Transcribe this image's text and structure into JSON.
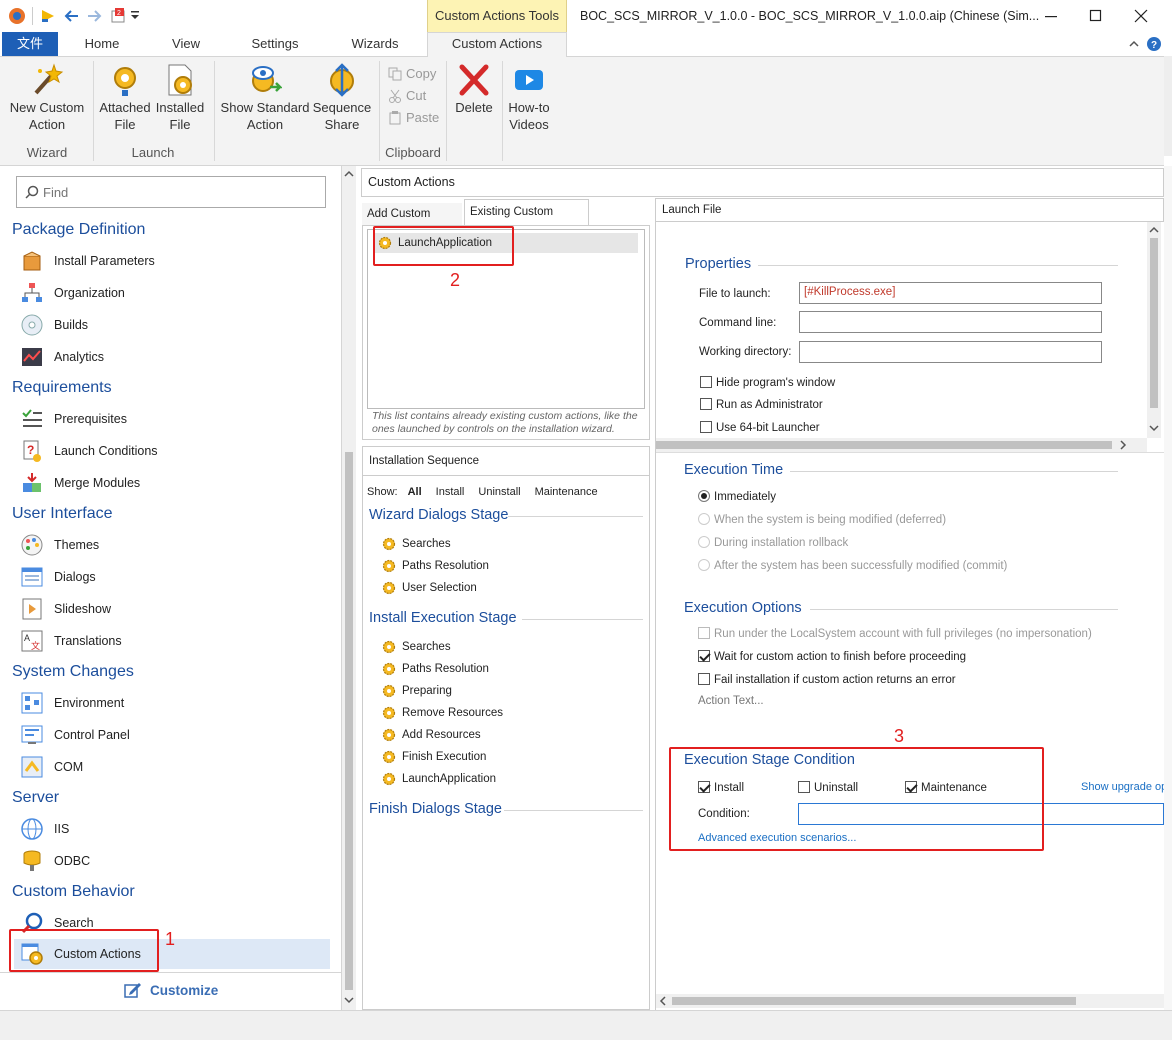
{
  "titlebar": {
    "context_tab": "Custom Actions Tools",
    "title": "BOC_SCS_MIRROR_V_1.0.0 - BOC_SCS_MIRROR_V_1.0.0.aip (Chinese (Sim..."
  },
  "tabs": {
    "file": "文件",
    "home": "Home",
    "view": "View",
    "settings": "Settings",
    "wizards": "Wizards",
    "custom_actions": "Custom Actions"
  },
  "ribbon": {
    "new_custom_action_1": "New Custom",
    "new_custom_action_2": "Action",
    "attached_file_1": "Attached",
    "attached_file_2": "File",
    "installed_file_1": "Installed",
    "installed_file_2": "File",
    "show_standard_1": "Show Standard",
    "show_standard_2": "Action",
    "sequence_share_1": "Sequence",
    "sequence_share_2": "Share",
    "copy": "Copy",
    "cut": "Cut",
    "paste": "Paste",
    "delete": "Delete",
    "howto_1": "How-to",
    "howto_2": "Videos",
    "group_wizard": "Wizard",
    "group_launch": "Launch",
    "group_clipboard": "Clipboard"
  },
  "sidebar": {
    "search_placeholder": "Find",
    "sections": {
      "package": "Package Definition",
      "requirements": "Requirements",
      "ui": "User Interface",
      "system": "System Changes",
      "server": "Server",
      "custom": "Custom Behavior"
    },
    "items": {
      "install_parameters": "Install Parameters",
      "organization": "Organization",
      "builds": "Builds",
      "analytics": "Analytics",
      "prerequisites": "Prerequisites",
      "launch_conditions": "Launch Conditions",
      "merge_modules": "Merge Modules",
      "themes": "Themes",
      "dialogs": "Dialogs",
      "slideshow": "Slideshow",
      "translations": "Translations",
      "environment": "Environment",
      "control_panel": "Control Panel",
      "com": "COM",
      "iis": "IIS",
      "odbc": "ODBC",
      "search": "Search",
      "custom_actions": "Custom Actions"
    },
    "customize": "Customize"
  },
  "center": {
    "header": "Custom Actions",
    "tab_add": "Add Custom Action",
    "tab_existing": "Existing Custom Actions",
    "existing_item": "LaunchApplication",
    "existing_note": "This list contains already existing custom actions, like the ones launched by controls on the installation wizard.",
    "seq_header": "Installation Sequence",
    "show_label": "Show:",
    "show_all": "All",
    "show_install": "Install",
    "show_uninstall": "Uninstall",
    "show_maintenance": "Maintenance",
    "stage_wizard": "Wizard Dialogs Stage",
    "wizard_items": [
      "Searches",
      "Paths Resolution",
      "User Selection"
    ],
    "stage_install": "Install Execution Stage",
    "install_items": [
      "Searches",
      "Paths Resolution",
      "Preparing",
      "Remove Resources",
      "Add Resources",
      "Finish Execution",
      "LaunchApplication"
    ],
    "stage_finish": "Finish Dialogs Stage"
  },
  "right": {
    "header": "Launch File",
    "properties": "Properties",
    "file_to_launch_label": "File to launch:",
    "file_to_launch_value": "[#KillProcess.exe]",
    "command_line_label": "Command line:",
    "working_dir_label": "Working directory:",
    "hide_window": "Hide program's window",
    "run_as_admin": "Run as Administrator",
    "use_64bit": "Use 64-bit Launcher",
    "exec_time": "Execution Time",
    "immediately": "Immediately",
    "deferred": "When the system is being modified (deferred)",
    "rollback": "During installation rollback",
    "commit": "After the system has been successfully modified (commit)",
    "exec_options": "Execution Options",
    "localsystem": "Run under the LocalSystem account with full privileges (no impersonation)",
    "wait_finish": "Wait for custom action to finish before proceeding",
    "fail_install": "Fail installation if custom action returns an error",
    "action_text": "Action Text...",
    "stage_condition": "Execution Stage Condition",
    "cond_install": "Install",
    "cond_uninstall": "Uninstall",
    "cond_maintenance": "Maintenance",
    "show_upgrade": "Show upgrade op",
    "condition_label": "Condition:",
    "advanced": "Advanced execution scenarios..."
  },
  "annotations": {
    "n1": "1",
    "n2": "2",
    "n3": "3"
  },
  "colors": {
    "accent": "#1c4e9c",
    "file_tab": "#1e5fb6",
    "context_tab": "#fdf3b4",
    "highlight": "#e21f1f",
    "selected": "#dde8f6"
  }
}
